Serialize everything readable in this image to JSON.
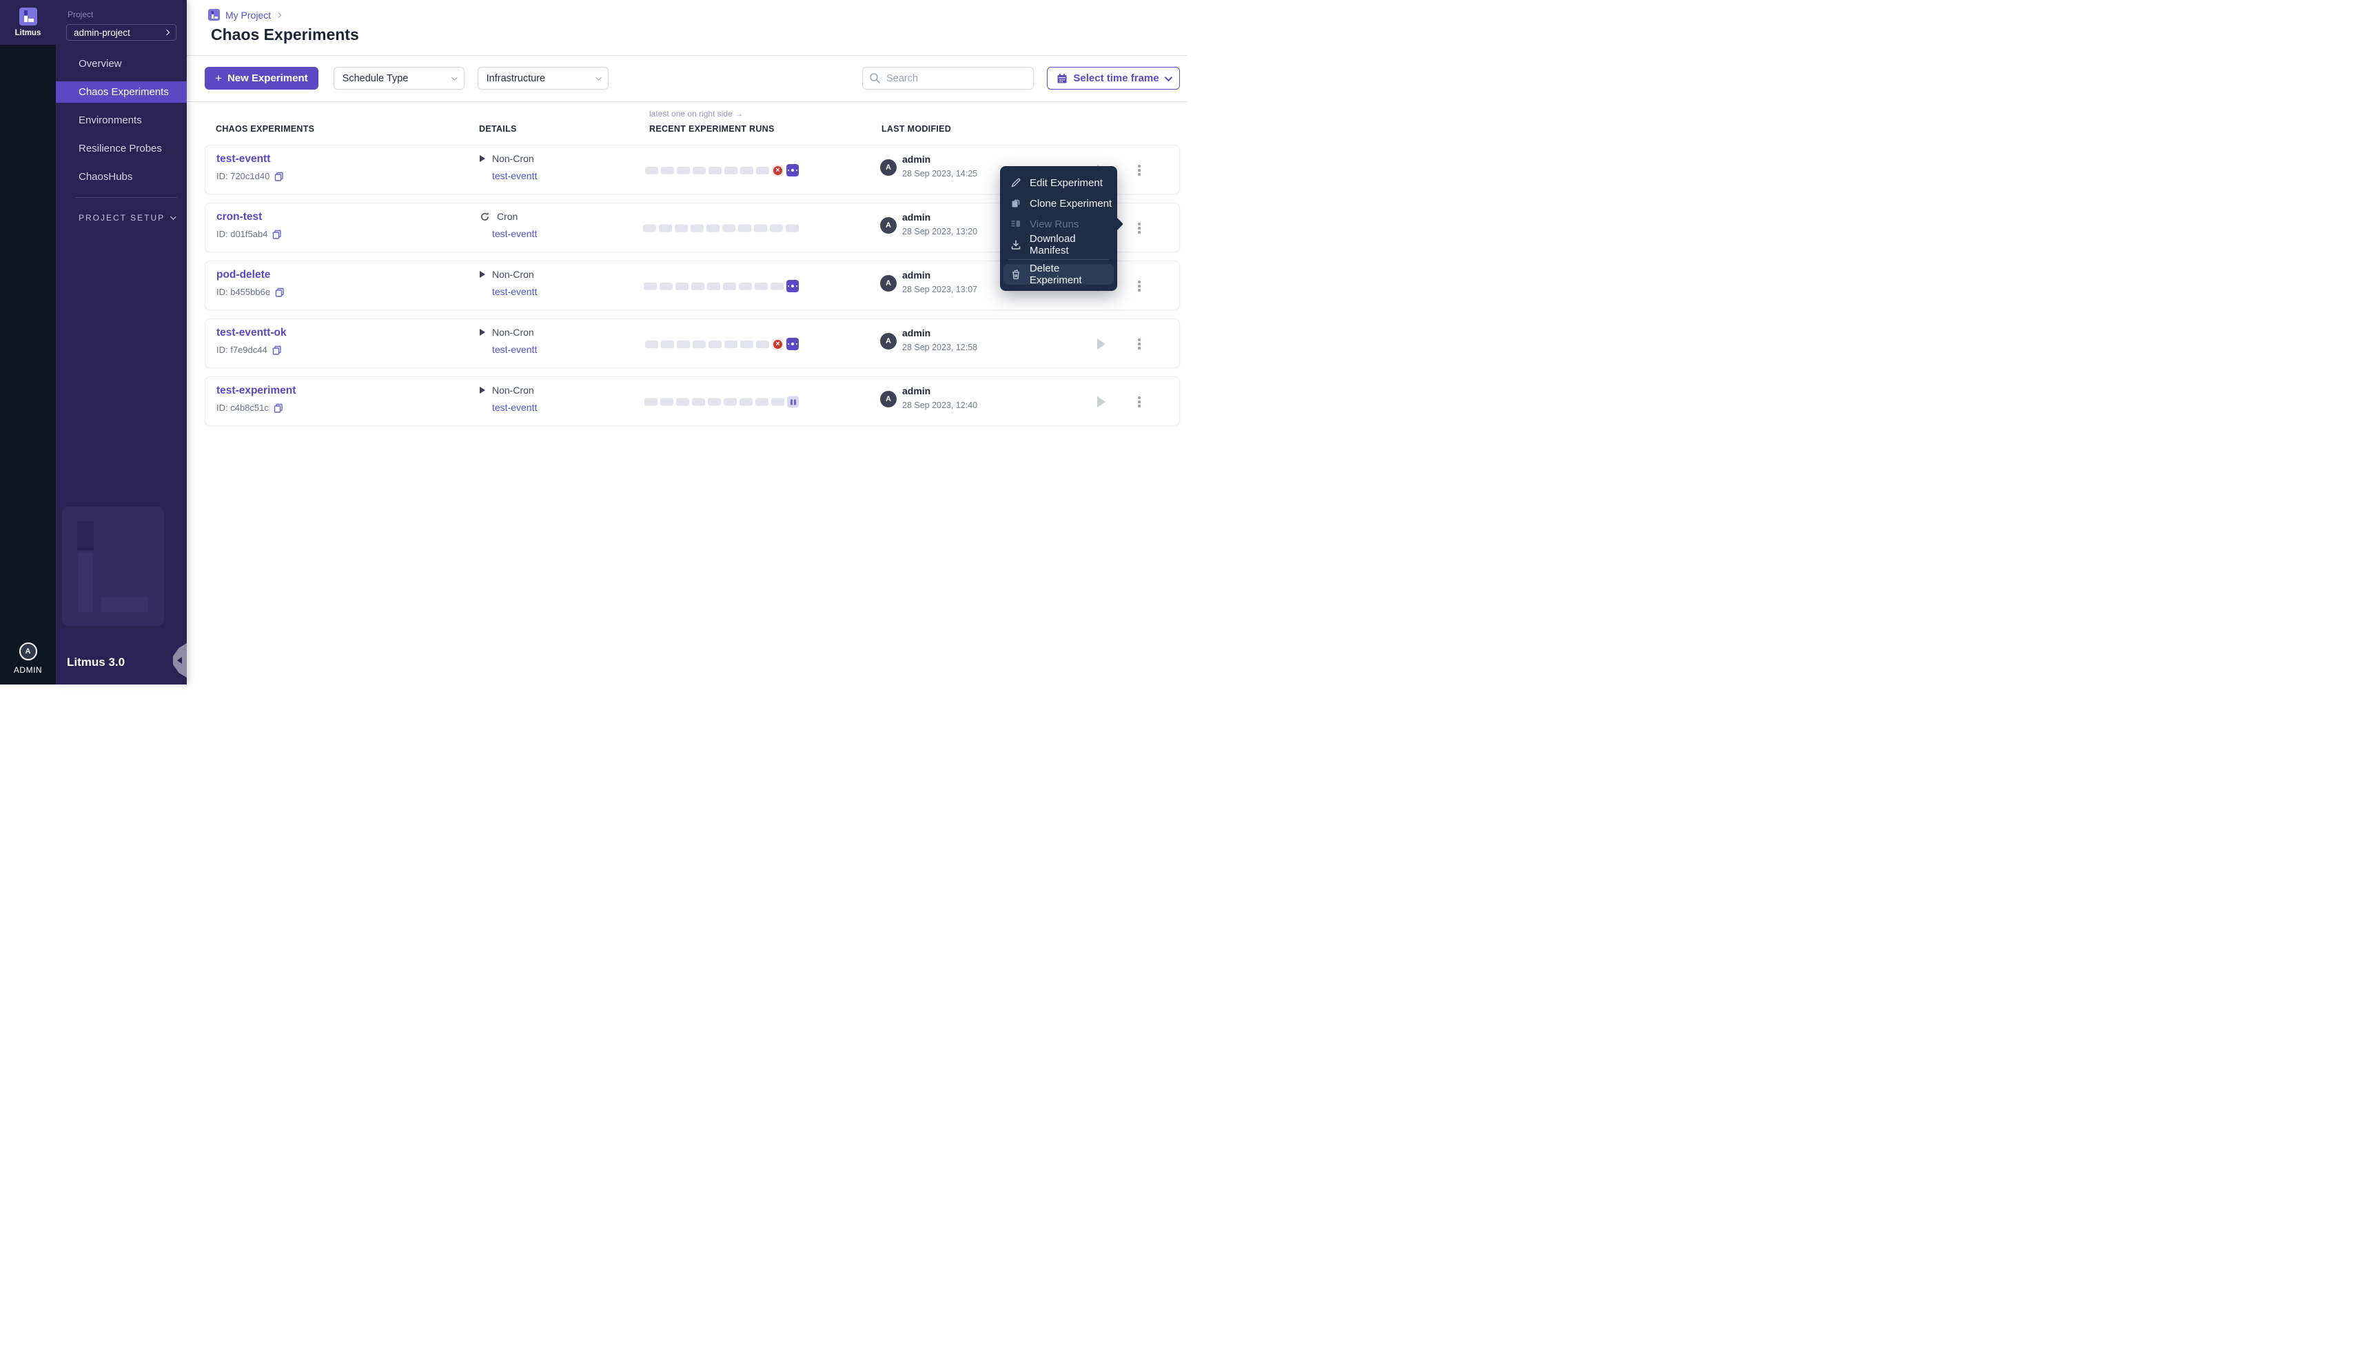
{
  "colors": {
    "accent": "#5c48c3",
    "sidebar_bg": "#2b2254",
    "rail_bg": "#0c1723",
    "menu_bg": "#1e2c45",
    "failed_red": "#c23b30",
    "link_purple": "#5752c8"
  },
  "sidebar": {
    "brand": "Litmus",
    "project_label": "Project",
    "project_name": "admin-project",
    "nav": [
      {
        "label": "Overview"
      },
      {
        "label": "Chaos Experiments"
      },
      {
        "label": "Environments"
      },
      {
        "label": "Resilience Probes"
      },
      {
        "label": "ChaosHubs"
      }
    ],
    "setup_label": "PROJECT SETUP",
    "version": "Litmus 3.0",
    "user_initial": "A",
    "user_role": "ADMIN"
  },
  "header": {
    "breadcrumb": "My Project",
    "title": "Chaos Experiments"
  },
  "toolbar": {
    "new_experiment_plus": "+",
    "new_experiment": "New Experiment",
    "schedule_type": "Schedule Type",
    "infrastructure": "Infrastructure",
    "search_placeholder": "Search",
    "time_frame": "Select time frame"
  },
  "table": {
    "hint": "latest one on right side →",
    "columns": [
      "CHAOS EXPERIMENTS",
      "DETAILS",
      "RECENT EXPERIMENT RUNS",
      "LAST MODIFIED"
    ],
    "rows": [
      {
        "name": "test-eventt",
        "id": "ID: 720c1d40",
        "schedule": "Non-Cron",
        "target": "test-eventt",
        "runs": [
          "empty",
          "empty",
          "empty",
          "empty",
          "empty",
          "empty",
          "empty",
          "empty",
          "failed",
          "running"
        ],
        "avatar": "A",
        "user": "admin",
        "modified": "28 Sep 2023, 14:25"
      },
      {
        "name": "cron-test",
        "id": "ID: d01f5ab4",
        "schedule": "Cron",
        "target": "test-eventt",
        "runs": [
          "empty",
          "empty",
          "empty",
          "empty",
          "empty",
          "empty",
          "empty",
          "empty",
          "empty",
          "empty"
        ],
        "avatar": "A",
        "user": "admin",
        "modified": "28 Sep 2023, 13:20"
      },
      {
        "name": "pod-delete",
        "id": "ID: b455bb6e",
        "schedule": "Non-Cron",
        "target": "test-eventt",
        "runs": [
          "empty",
          "empty",
          "empty",
          "empty",
          "empty",
          "empty",
          "empty",
          "empty",
          "empty",
          "running"
        ],
        "avatar": "A",
        "user": "admin",
        "modified": "28 Sep 2023, 13:07"
      },
      {
        "name": "test-eventt-ok",
        "id": "ID: f7e9dc44",
        "schedule": "Non-Cron",
        "target": "test-eventt",
        "runs": [
          "empty",
          "empty",
          "empty",
          "empty",
          "empty",
          "empty",
          "empty",
          "empty",
          "failed",
          "running"
        ],
        "avatar": "A",
        "user": "admin",
        "modified": "28 Sep 2023, 12:58"
      },
      {
        "name": "test-experiment",
        "id": "ID: c4b8c51c",
        "schedule": "Non-Cron",
        "target": "test-eventt",
        "runs": [
          "empty",
          "empty",
          "empty",
          "empty",
          "empty",
          "empty",
          "empty",
          "empty",
          "empty",
          "paused"
        ],
        "avatar": "A",
        "user": "admin",
        "modified": "28 Sep 2023, 12:40"
      }
    ]
  },
  "menu": {
    "items": [
      {
        "label": "Edit Experiment"
      },
      {
        "label": "Clone Experiment"
      },
      {
        "label": "View Runs"
      },
      {
        "label": "Download Manifest"
      },
      {
        "label": "Delete Experiment"
      }
    ]
  }
}
